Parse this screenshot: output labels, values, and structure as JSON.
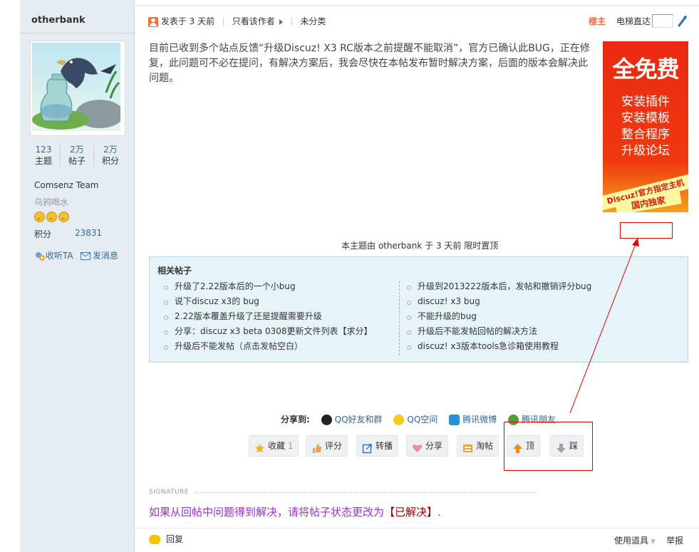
{
  "author": {
    "name": "otherbank",
    "stats": [
      {
        "value": "123",
        "label": "主题"
      },
      {
        "value": "2万",
        "label": "帖子"
      },
      {
        "value": "2万",
        "label": "积分"
      }
    ],
    "group": "Comsenz Team",
    "custom_title": "乌鸦喝水",
    "credits_label": "积分",
    "credits_value": "23831",
    "follow_label": "收听TA",
    "message_label": "发消息"
  },
  "post_header": {
    "posted": "发表于 3 天前",
    "only_author": "只看该作者",
    "category": "未分类",
    "floor": "楼主",
    "elevator": "电梯直达"
  },
  "post": {
    "message": "目前已收到多个站点反馈“升级Discuz! X3 RC版本之前提醒不能取消”，官方已确认此BUG，正在修复，此问题可不必在提问，有解决方案后，我会尽快在本帖发布暂时解决方案，后面的版本会解决此问题。",
    "sticky_note": "本主题由 otherbank 于 3 天前 限时置顶"
  },
  "ad": {
    "headline": "全免费",
    "lines": [
      "安装插件",
      "安装模板",
      "整合程序",
      "升级论坛"
    ],
    "band": "Discuz!官方指定主机",
    "badge": "国内独家"
  },
  "related": {
    "title": "相关帖子",
    "left": [
      "升级了2.22版本后的一个小bug",
      "说下discuz x3的 bug",
      "2.22版本覆盖升级了还是提醒需要升级",
      "分享：discuz x3 beta 0308更新文件列表【求分】",
      "升级后不能发帖（点击发帖空白）"
    ],
    "right": [
      "升级到2013222版本后，发帖和撤销评分bug",
      "discuz! x3 bug",
      "不能升级的bug",
      "升级后不能发帖回帖的解决方法",
      "discuz! x3版本tools急诊箱使用教程"
    ]
  },
  "share": {
    "label": "分享到:",
    "targets": [
      "QQ好友和群",
      "QQ空间",
      "腾讯微博",
      "腾讯朋友"
    ]
  },
  "actions": {
    "favorite": "收藏",
    "favorite_count": "1",
    "rate": "评分",
    "repost": "转播",
    "share": "分享",
    "tao": "淘帖",
    "up": "顶",
    "down": "踩"
  },
  "signature": {
    "label": "SIGNATURE",
    "text_before": "如果从回帖中问题得到解决，请将帖子状态更改为",
    "text_highlight": "【已解决】",
    "text_after": "."
  },
  "footer": {
    "reply": "回复",
    "tools": "使用道具",
    "report": "举报"
  },
  "colors": {
    "sidebar_bg": "#e5edf2",
    "link": "#336699",
    "floor_owner": "#f26c4f",
    "signature": "#9933cc",
    "annotation_red": "#e50000"
  }
}
